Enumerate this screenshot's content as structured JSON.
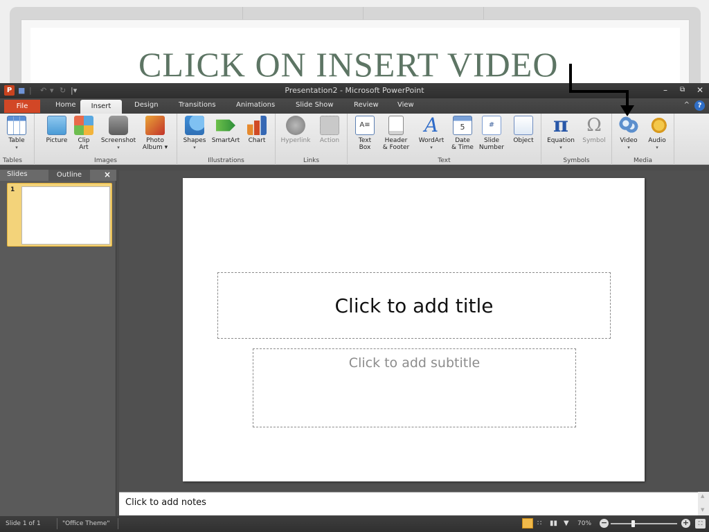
{
  "instruction": {
    "text": "CLICK ON INSERT VIDEO"
  },
  "window": {
    "title": "Presentation2 - Microsoft PowerPoint",
    "app_icon": "P"
  },
  "ribbon_tabs": {
    "file": "File",
    "home": "Home",
    "insert": "Insert",
    "design": "Design",
    "transitions": "Transitions",
    "animations": "Animations",
    "slide_show": "Slide Show",
    "review": "Review",
    "view": "View"
  },
  "groups": {
    "tables": "Tables",
    "images": "Images",
    "illustrations": "Illustrations",
    "links": "Links",
    "text": "Text",
    "symbols": "Symbols",
    "media": "Media"
  },
  "buttons": {
    "table": "Table",
    "picture": "Picture",
    "clip_art_1": "Clip",
    "clip_art_2": "Art",
    "screenshot": "Screenshot",
    "photo_album_1": "Photo",
    "photo_album_2": "Album",
    "shapes": "Shapes",
    "smartart": "SmartArt",
    "chart": "Chart",
    "hyperlink": "Hyperlink",
    "action": "Action",
    "text_box_1": "Text",
    "text_box_2": "Box",
    "header_footer_1": "Header",
    "header_footer_2": "& Footer",
    "wordart": "WordArt",
    "date_time_1": "Date",
    "date_time_2": "& Time",
    "slide_number_1": "Slide",
    "slide_number_2": "Number",
    "object": "Object",
    "equation": "Equation",
    "symbol": "Symbol",
    "video": "Video",
    "audio": "Audio"
  },
  "left_pane": {
    "slides_tab": "Slides",
    "outline_tab": "Outline",
    "close": "×",
    "thumb_number": "1"
  },
  "slide": {
    "title_placeholder": "Click to add title",
    "subtitle_placeholder": "Click to add subtitle"
  },
  "notes": {
    "placeholder": "Click to add notes"
  },
  "statusbar": {
    "slide_info": "Slide 1 of 1",
    "theme": "\"Office Theme\"",
    "zoom": "70%"
  },
  "colors": {
    "file_tab": "#d24726",
    "instruction_text": "#5d7564",
    "selected_thumb": "#f3d37a"
  }
}
